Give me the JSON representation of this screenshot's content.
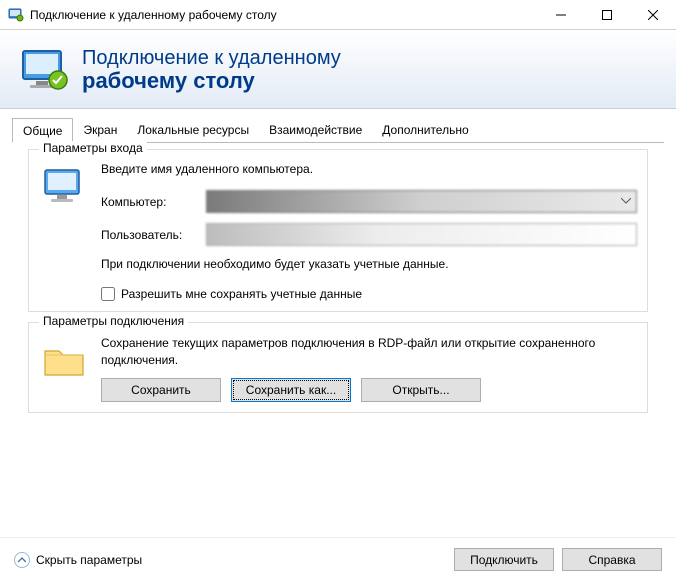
{
  "window": {
    "title": "Подключение к удаленному рабочему столу"
  },
  "header": {
    "line1": "Подключение к удаленному",
    "line2": "рабочему столу"
  },
  "tabs": [
    {
      "label": "Общие"
    },
    {
      "label": "Экран"
    },
    {
      "label": "Локальные ресурсы"
    },
    {
      "label": "Взаимодействие"
    },
    {
      "label": "Дополнительно"
    }
  ],
  "login": {
    "legend": "Параметры входа",
    "instruction": "Введите имя удаленного компьютера.",
    "computer_label": "Компьютер:",
    "computer_value": "r··················51···",
    "user_label": "Пользователь:",
    "user_value": "···",
    "note": "При подключении необходимо будет указать учетные данные.",
    "save_creds_label": "Разрешить мне сохранять учетные данные"
  },
  "connection": {
    "legend": "Параметры подключения",
    "description": "Сохранение текущих параметров подключения в RDP-файл или открытие сохраненного подключения.",
    "save": "Сохранить",
    "save_as": "Сохранить как...",
    "open": "Открыть..."
  },
  "footer": {
    "hide": "Скрыть параметры",
    "connect": "Подключить",
    "help": "Справка"
  }
}
